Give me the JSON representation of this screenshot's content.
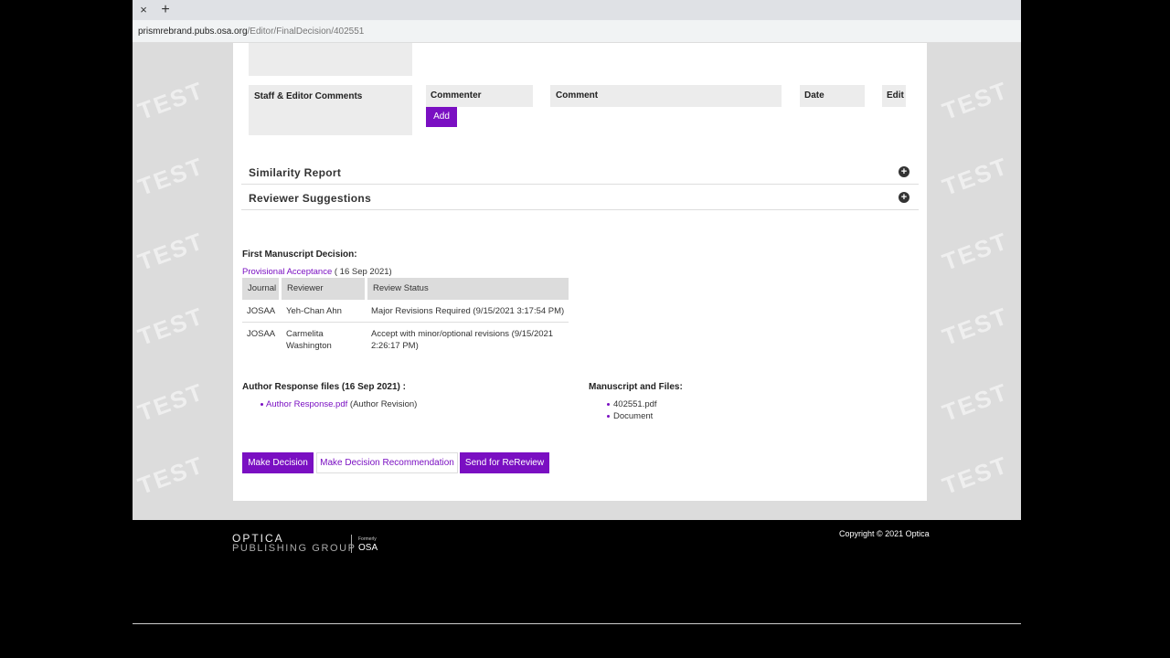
{
  "browser": {
    "url_host": "prismrebrand.pubs.osa.org",
    "url_path": "/Editor/FinalDecision/402551",
    "close_tab": "×",
    "new_tab": "+"
  },
  "watermark_text": "TEST",
  "comments": {
    "label": "Staff & Editor Comments",
    "col_commenter": "Commenter",
    "col_comment": "Comment",
    "col_date": "Date",
    "col_edit": "Edit",
    "add_button": "Add"
  },
  "sections": [
    {
      "title": "Similarity Report"
    },
    {
      "title": "Reviewer Suggestions"
    }
  ],
  "decision": {
    "heading": "First Manuscript Decision:",
    "status_link": "Provisional Acceptance",
    "status_date": "( 16 Sep 2021)",
    "table_headers": [
      "Journal",
      "Reviewer",
      "Review Status"
    ],
    "rows": [
      {
        "journal": "JOSAA",
        "reviewer": "Yeh-Chan Ahn",
        "reviewer_line2": "",
        "status": "Major Revisions Required (9/15/2021 3:17:54 PM)",
        "status_line2": ""
      },
      {
        "journal": "JOSAA",
        "reviewer": "Carmelita",
        "reviewer_line2": "Washington",
        "status": "Accept with minor/optional revisions (9/15/2021",
        "status_line2": "2:26:17 PM)"
      }
    ]
  },
  "author_response": {
    "heading": "Author Response files (16 Sep 2021) :",
    "file_link": "Author Response.pdf",
    "file_note": "(Author Revision)"
  },
  "manuscript": {
    "heading": "Manuscript and Files:",
    "files": [
      "402551.pdf",
      "Document"
    ]
  },
  "actions": {
    "make_decision": "Make Decision",
    "make_recommendation": "Make Decision Recommendation",
    "send_rereview": "Send for ReReview"
  },
  "footer": {
    "logo_line1": "OPTICA",
    "logo_line2": "PUBLISHING GROUP",
    "formerly": "Formerly",
    "osa": "OSA",
    "copyright": "Copyright © 2021 Optica"
  },
  "colors": {
    "accent": "#7a0fc2",
    "page_bg": "#dcdcdc"
  }
}
